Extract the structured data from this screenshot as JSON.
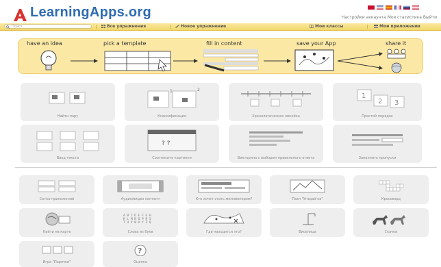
{
  "header": {
    "logo_text": "LearningApps.org",
    "top_links": "Настройки аккаунта   Моя статистика   Выйти",
    "flag_colors": [
      "#c8102e",
      "#1f3f8f",
      "#f2c200",
      "#c8102e",
      "#1f3f8f",
      "#c8102e"
    ]
  },
  "navbar": {
    "search_placeholder": "Поиск",
    "items": [
      {
        "label": "Все упражнения",
        "icon": "grid-icon"
      },
      {
        "label": "Новое упражнение",
        "icon": "pencil-icon"
      },
      {
        "label": "Мои классы",
        "icon": "class-icon"
      },
      {
        "label": "Мои приложения",
        "icon": "apps-icon"
      }
    ]
  },
  "banner": {
    "steps": [
      "have an idea",
      "pick a template",
      "fill in content",
      "save your App",
      "share it"
    ]
  },
  "templates_row1": [
    "Найти пару",
    "Классификация",
    "Хронологическая линейка",
    "Простой порядок"
  ],
  "templates_row2": [
    "Ввод текста",
    "Соотнесите картинки",
    "Викторина с выбором правильного ответа",
    "Заполнить пропуски"
  ],
  "templates_row3": [
    "Сетка приложений",
    "Аудио/видео контент",
    "Кто хочет стать миллионером?",
    "Пазл \"Угадай-ка\"",
    "Кроссворд"
  ],
  "templates_row4": [
    "Найти на карте",
    "Слова из букв",
    "Где находится это?",
    "Виселица",
    "Скачки"
  ],
  "templates_row5": [
    "Игра \"Парочки\"",
    "Оценка"
  ],
  "colors": {
    "accent": "#f1d76a",
    "banner": "#fbe8a5",
    "logo": "#2f6cb0",
    "tile": "#eeeeee"
  }
}
